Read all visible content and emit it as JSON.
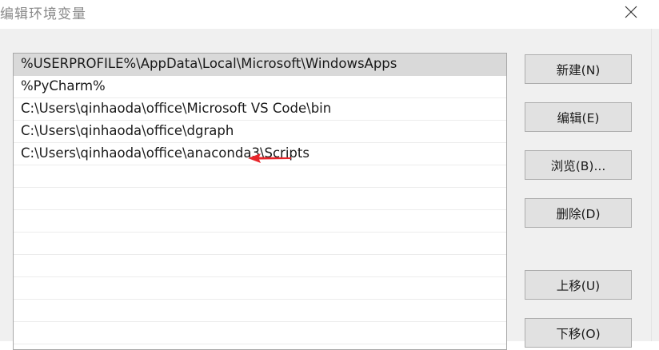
{
  "window": {
    "title": "编辑环境变量",
    "close_icon": "close-icon"
  },
  "path_list": {
    "items": [
      {
        "label": "%USERPROFILE%\\AppData\\Local\\Microsoft\\WindowsApps",
        "selected": true
      },
      {
        "label": "%PyCharm%",
        "selected": false
      },
      {
        "label": "C:\\Users\\qinhaoda\\office\\Microsoft VS Code\\bin",
        "selected": false
      },
      {
        "label": "C:\\Users\\qinhaoda\\office\\dgraph",
        "selected": false
      },
      {
        "label": "C:\\Users\\qinhaoda\\office\\anaconda3\\Scripts",
        "selected": false
      }
    ],
    "annotation": {
      "icon": "red-arrow-icon",
      "color": "#e8262b"
    }
  },
  "buttons": {
    "new_label": "新建(N)",
    "edit_label": "编辑(E)",
    "browse_label": "浏览(B)...",
    "delete_label": "删除(D)",
    "move_up_label": "上移(U)",
    "move_down_label": "下移(O)"
  },
  "colors": {
    "selection": "#d9d9d9",
    "dialog_bg": "#f0f0f0",
    "button_bg": "#e1e1e1"
  }
}
